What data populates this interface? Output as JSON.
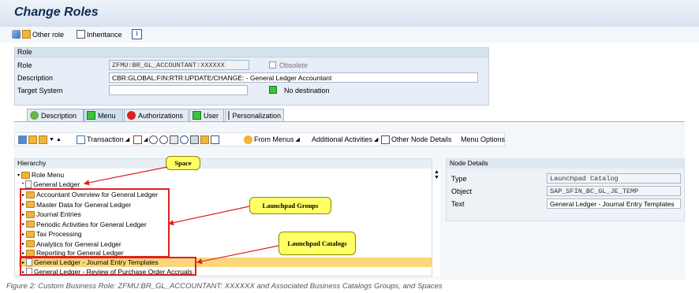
{
  "window": {
    "title": "Change Roles"
  },
  "toolbar": {
    "other_role": "Other role",
    "inheritance": "Inheritance"
  },
  "role": {
    "section_label": "Role",
    "role_label": "Role",
    "role_value": "ZFMU:BR_GL_ACCOUNTANT:XXXXXX",
    "obsolete_label": "Obsolete",
    "description_label": "Description",
    "description_value": "CBR:GLOBAL:FIN:RTR:UPDATE/CHANGE: - General Ledger Accountant",
    "target_label": "Target System",
    "target_value": "",
    "destination_label": "No destination"
  },
  "tabs": [
    {
      "label": "Description"
    },
    {
      "label": "Menu"
    },
    {
      "label": "Authorizations"
    },
    {
      "label": "User"
    },
    {
      "label": "Personalization"
    }
  ],
  "menu_toolbar": {
    "transaction": "Transaction",
    "from_menus": "From Menus",
    "additional": "Additional Activities",
    "other_node": "Other Node Details",
    "menu_options": "Menu Options"
  },
  "hierarchy": {
    "header": "Hierarchy",
    "root": "Role Menu",
    "space": "General Ledger",
    "groups": [
      "Accountant Overview for General Ledger",
      "Master Data for General Ledger",
      "Journal Entries",
      "Periodic Activities for General Ledger",
      "Tax Processing",
      "Analytics for General Ledger",
      "Reporting for General Ledger"
    ],
    "catalogs": [
      "General Ledger - Journal Entry Templates",
      "General Ledger - Review of Purchase Order Accruals"
    ]
  },
  "node_details": {
    "header": "Node Details",
    "type_label": "Type",
    "type_value": "Launchpad Catalog",
    "object_label": "Object",
    "object_value": "SAP_SFIN_BC_GL_JE_TEMP",
    "text_label": "Text",
    "text_value": "General Ledger - Journal Entry Templates"
  },
  "callouts": {
    "space": "Space",
    "groups": "Launchpad Groups",
    "catalogs": "Launchpad Catalogs"
  },
  "caption": "Figure 2: Custom Business Role: ZFMU:BR_GL_ACCOUNTANT: XXXXXX and Associated Business Catalogs Groups, and Spaces",
  "colors": {
    "title": "#0d2a52",
    "callout": "#ffff66",
    "highlight": "#fbd67a",
    "arrow": "#e02020"
  }
}
